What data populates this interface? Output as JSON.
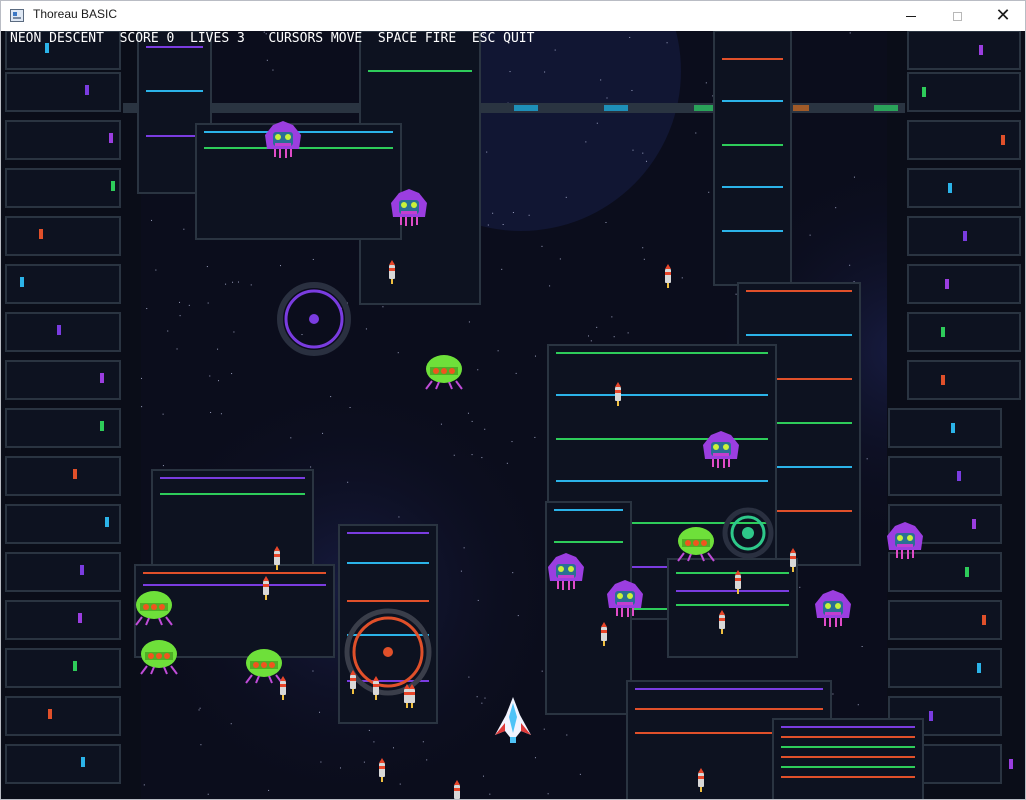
{
  "window": {
    "title": "Thoreau BASIC"
  },
  "hud": {
    "game_title": "NEON DESCENT",
    "score": "SCORE 0",
    "lives": "LIVES 3",
    "hint_move": "CURSORS MOVE",
    "hint_fire": "SPACE FIRE",
    "hint_quit": "ESC QUIT"
  },
  "colors": {
    "space": "#0b0d1c",
    "panel": "#0d1220",
    "panel_border": "#2a3441",
    "neon_blue": "#2bb3e8",
    "neon_green": "#2ecc5a",
    "neon_orange": "#e0502a",
    "neon_purple": "#7a3ce0",
    "hooded_enemy": "#9b3ee0",
    "bug_enemy": "#6ee03a",
    "player_ship": "#f2f4ff"
  }
}
